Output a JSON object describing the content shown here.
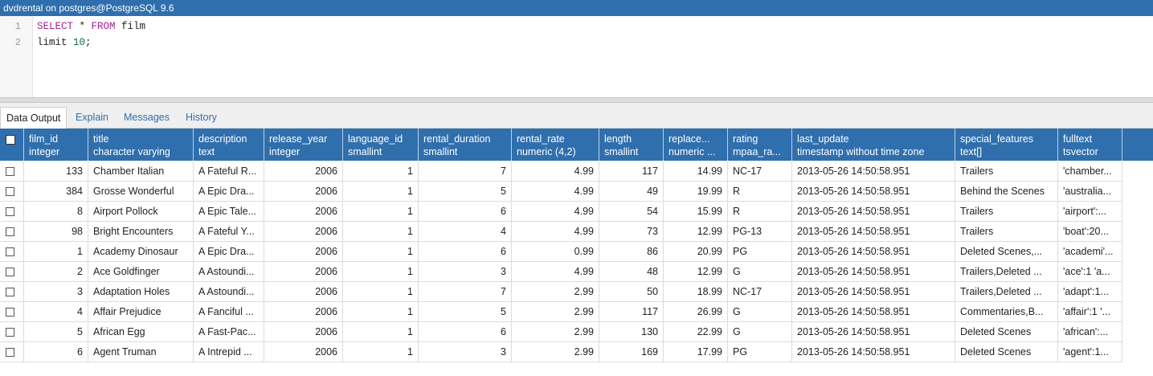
{
  "window": {
    "title": "dvdrental on postgres@PostgreSQL 9.6"
  },
  "editor": {
    "line_numbers": [
      "1",
      "2"
    ],
    "line1": {
      "kw1": "SELECT",
      "mid": " * ",
      "kw2": "FROM",
      "rest": " film"
    },
    "line2": {
      "pre": "limit ",
      "num": "10",
      "post": ";"
    }
  },
  "tabs": [
    {
      "label": "Data Output",
      "active": true
    },
    {
      "label": "Explain",
      "active": false
    },
    {
      "label": "Messages",
      "active": false
    },
    {
      "label": "History",
      "active": false
    }
  ],
  "table": {
    "columns": [
      {
        "name": "film_id",
        "type": "integer"
      },
      {
        "name": "title",
        "type": "character varying"
      },
      {
        "name": "description",
        "type": "text"
      },
      {
        "name": "release_year",
        "type": "integer"
      },
      {
        "name": "language_id",
        "type": "smallint"
      },
      {
        "name": "rental_duration",
        "type": "smallint"
      },
      {
        "name": "rental_rate",
        "type": "numeric (4,2)"
      },
      {
        "name": "length",
        "type": "smallint"
      },
      {
        "name": "replace...",
        "type": "numeric ..."
      },
      {
        "name": "rating",
        "type": "mpaa_ra..."
      },
      {
        "name": "last_update",
        "type": "timestamp without time zone"
      },
      {
        "name": "special_features",
        "type": "text[]"
      },
      {
        "name": "fulltext",
        "type": "tsvector"
      }
    ],
    "rows": [
      [
        "133",
        "Chamber Italian",
        "A Fateful R...",
        "2006",
        "1",
        "7",
        "4.99",
        "117",
        "14.99",
        "NC-17",
        "2013-05-26 14:50:58.951",
        "Trailers",
        "'chamber..."
      ],
      [
        "384",
        "Grosse Wonderful",
        "A Epic Dra...",
        "2006",
        "1",
        "5",
        "4.99",
        "49",
        "19.99",
        "R",
        "2013-05-26 14:50:58.951",
        "Behind the Scenes",
        "'australia..."
      ],
      [
        "8",
        "Airport Pollock",
        "A Epic Tale...",
        "2006",
        "1",
        "6",
        "4.99",
        "54",
        "15.99",
        "R",
        "2013-05-26 14:50:58.951",
        "Trailers",
        "'airport':..."
      ],
      [
        "98",
        "Bright Encounters",
        "A Fateful Y...",
        "2006",
        "1",
        "4",
        "4.99",
        "73",
        "12.99",
        "PG-13",
        "2013-05-26 14:50:58.951",
        "Trailers",
        "'boat':20..."
      ],
      [
        "1",
        "Academy Dinosaur",
        "A Epic Dra...",
        "2006",
        "1",
        "6",
        "0.99",
        "86",
        "20.99",
        "PG",
        "2013-05-26 14:50:58.951",
        "Deleted Scenes,...",
        "'academi'..."
      ],
      [
        "2",
        "Ace Goldfinger",
        "A Astoundi...",
        "2006",
        "1",
        "3",
        "4.99",
        "48",
        "12.99",
        "G",
        "2013-05-26 14:50:58.951",
        "Trailers,Deleted ...",
        "'ace':1 'a..."
      ],
      [
        "3",
        "Adaptation Holes",
        "A Astoundi...",
        "2006",
        "1",
        "7",
        "2.99",
        "50",
        "18.99",
        "NC-17",
        "2013-05-26 14:50:58.951",
        "Trailers,Deleted ...",
        "'adapt':1..."
      ],
      [
        "4",
        "Affair Prejudice",
        "A Fanciful ...",
        "2006",
        "1",
        "5",
        "2.99",
        "117",
        "26.99",
        "G",
        "2013-05-26 14:50:58.951",
        "Commentaries,B...",
        "'affair':1 '..."
      ],
      [
        "5",
        "African Egg",
        "A Fast-Pac...",
        "2006",
        "1",
        "6",
        "2.99",
        "130",
        "22.99",
        "G",
        "2013-05-26 14:50:58.951",
        "Deleted Scenes",
        "'african':..."
      ],
      [
        "6",
        "Agent Truman",
        "A Intrepid ...",
        "2006",
        "1",
        "3",
        "2.99",
        "169",
        "17.99",
        "PG",
        "2013-05-26 14:50:58.951",
        "Deleted Scenes",
        "'agent':1..."
      ]
    ]
  }
}
